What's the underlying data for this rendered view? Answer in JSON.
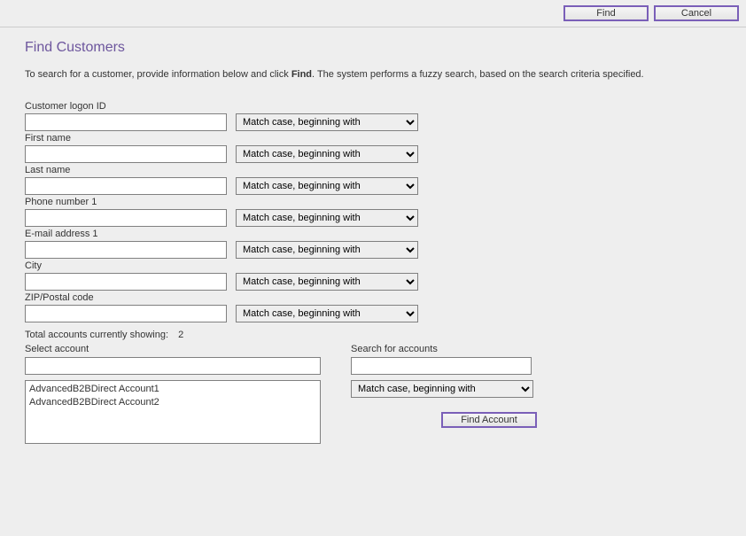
{
  "toolbar": {
    "find_label": "Find",
    "cancel_label": "Cancel"
  },
  "page": {
    "title": "Find Customers",
    "intro_pre": "To search for a customer, provide information below and click ",
    "intro_bold": "Find",
    "intro_post": ". The system performs a fuzzy search, based on the search criteria specified."
  },
  "match_option": "Match case, beginning with",
  "fields": {
    "logon": {
      "label": "Customer logon ID",
      "value": ""
    },
    "first_name": {
      "label": "First name",
      "value": ""
    },
    "last_name": {
      "label": "Last name",
      "value": ""
    },
    "phone1": {
      "label": "Phone number 1",
      "value": ""
    },
    "email1": {
      "label": "E-mail address 1",
      "value": ""
    },
    "city": {
      "label": "City",
      "value": ""
    },
    "zip": {
      "label": "ZIP/Postal code",
      "value": ""
    }
  },
  "totals": {
    "label": "Total accounts currently showing:",
    "count": "2"
  },
  "accounts": {
    "select_label": "Select account",
    "selected_value": "",
    "items": [
      "AdvancedB2BDirect Account1",
      "AdvancedB2BDirect Account2"
    ],
    "search_label": "Search for accounts",
    "search_value": "",
    "find_account_label": "Find Account"
  }
}
